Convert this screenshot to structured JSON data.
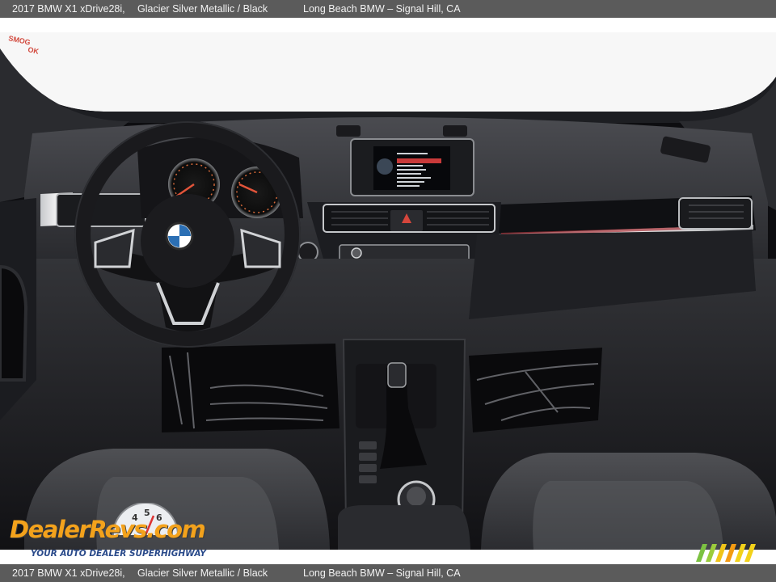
{
  "caption": {
    "model": "2017 BMW X1 xDrive28i,",
    "color": "Glacier Silver Metallic  / Black",
    "dealer": "Long Beach BMW – Signal Hill, CA"
  },
  "photo": {
    "subject": "BMW X1 interior dashboard",
    "windshield_sticker_lines": [
      "SMOG",
      "OK"
    ],
    "infotainment_menu": [
      "Multimedia",
      "Radio",
      "Telephone",
      "Navigation",
      "Contacts",
      "ConnectedDrive",
      "Vehicle info",
      "Settings"
    ]
  },
  "watermark": {
    "logo_text": "DealerRevs.com",
    "tagline": "YOUR AUTO DEALER SUPERHIGHWAY",
    "colors": {
      "logo": "#f3a21c",
      "tagline": "#2a4a8a"
    }
  },
  "colors": {
    "caption_bar": "#5b5b5b",
    "caption_text": "#f2f2f2"
  }
}
